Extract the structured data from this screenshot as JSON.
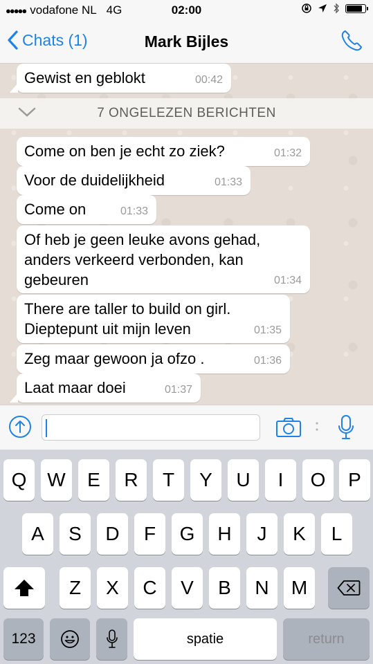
{
  "status_bar": {
    "carrier": "vodafone NL",
    "network": "4G",
    "time": "02:00",
    "battery_level": 0.9
  },
  "nav": {
    "back_label": "Chats (1)",
    "contact_name": "Mark Bijles",
    "call_icon": "phone-icon"
  },
  "chat": {
    "earlier_message": {
      "text": "Gewist en geblokt",
      "time": "00:42"
    },
    "unread_banner": "7 ONGELEZEN BERICHTEN",
    "messages": [
      {
        "text": "Come on ben je echt zo ziek?",
        "time": "01:32"
      },
      {
        "text": "Voor de duidelijkheid",
        "time": "01:33"
      },
      {
        "text": "Come on",
        "time": "01:33"
      },
      {
        "text": "Of heb je geen leuke avons gehad,\nanders verkeerd verbonden, kan\ngebeuren",
        "time": "01:34"
      },
      {
        "text": "There are taller to build on girl.\nDieptepunt uit mijn leven",
        "time": "01:35"
      },
      {
        "text": "Zeg maar gewoon ja ofzo .",
        "time": "01:36"
      },
      {
        "text": "Laat maar doei",
        "time": "01:37"
      }
    ]
  },
  "input_bar": {
    "message_value": "",
    "icons": [
      "share-icon",
      "camera-icon",
      "microphone-icon"
    ]
  },
  "keyboard": {
    "row1": [
      "Q",
      "W",
      "E",
      "R",
      "T",
      "Y",
      "U",
      "I",
      "O",
      "P"
    ],
    "row2": [
      "A",
      "S",
      "D",
      "F",
      "G",
      "H",
      "J",
      "K",
      "L"
    ],
    "row3": [
      "Z",
      "X",
      "C",
      "V",
      "B",
      "N",
      "M"
    ],
    "numbers_key": "123",
    "space_key": "spatie",
    "return_key": "return"
  },
  "colors": {
    "accent": "#1e82e8",
    "chat_background": "#e5ddd5",
    "bubble": "#ffffff",
    "keyboard": "#d1d5db"
  }
}
